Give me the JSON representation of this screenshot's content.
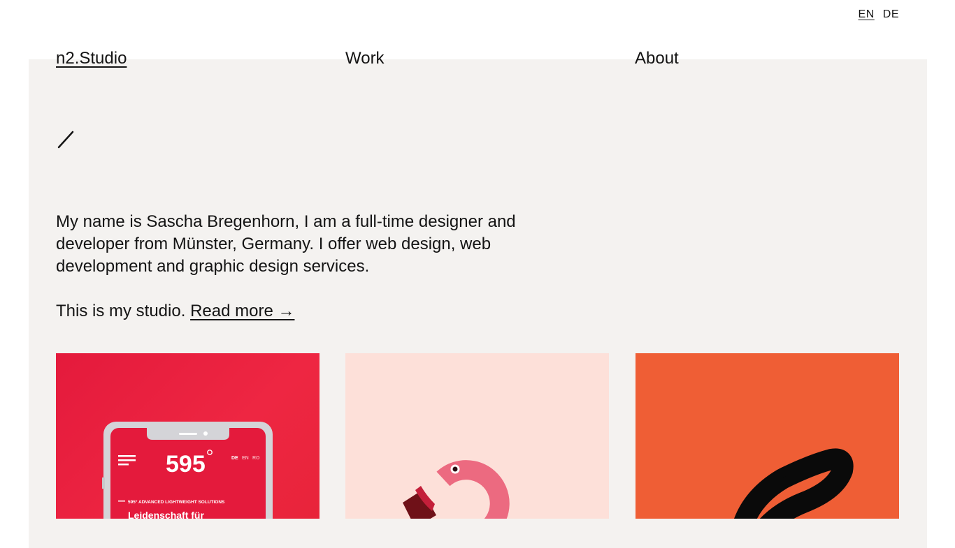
{
  "language_switch": {
    "items": [
      {
        "label": "EN",
        "active": true
      },
      {
        "label": "DE",
        "active": false
      }
    ]
  },
  "nav": {
    "logo": "n2.Studio",
    "work": "Work",
    "about": "About"
  },
  "intro": {
    "text": "My name is Sascha Bregenhorn, I am a full-time designer and developer from Münster, Germany. I offer web design, web development and graphic design services.",
    "studio_text": "This is my studio.",
    "read_more": "Read more →"
  },
  "projects": [
    {
      "name": "595",
      "brand": "595",
      "lang_items": [
        "DE",
        "EN",
        "RO"
      ],
      "tagline": "595° ADVANCED LIGHTWEIGHT SOLUTIONS",
      "headline": "Leidenschaft für",
      "bg_color": "#e41a3c"
    },
    {
      "illustration": "flamingo-icon",
      "bg_color": "#fde0d9",
      "accent_color": "#ec6a80"
    },
    {
      "illustration": "brush-lettering-icon",
      "bg_color": "#ef5e35"
    }
  ],
  "colors": {
    "panel": "#f4f2f0",
    "text": "#141414"
  }
}
